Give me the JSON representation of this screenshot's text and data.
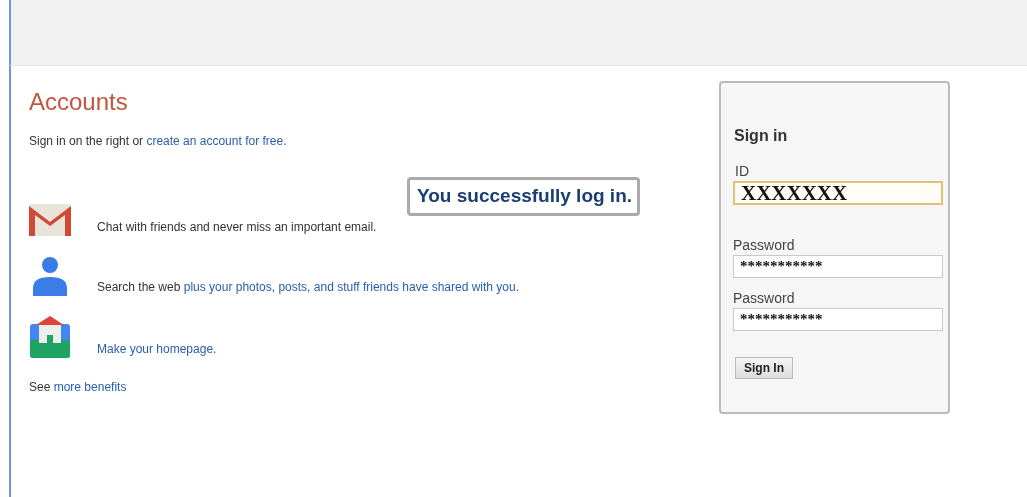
{
  "heading": "Accounts",
  "intro": [
    {
      "kind": "plain",
      "text": "Sign in on the right or "
    },
    {
      "kind": "link",
      "text": "create an account for free."
    }
  ],
  "message": "You successfully log in.",
  "features": [
    {
      "kind": "mail",
      "parts": [
        {
          "kind": "plain",
          "text": "Chat with friends and never miss an important email."
        }
      ]
    },
    {
      "kind": "person",
      "parts": [
        {
          "kind": "plain",
          "text": "Search the web "
        },
        {
          "kind": "link",
          "text": "plus your photos, posts, and stuff friends have shared with you."
        }
      ]
    },
    {
      "kind": "home",
      "parts": [
        {
          "kind": "link",
          "text": "Make your homepage."
        }
      ]
    }
  ],
  "more": [
    {
      "kind": "plain",
      "text": "See "
    },
    {
      "kind": "link",
      "text": "more benefits"
    }
  ],
  "signin": {
    "title": "Sign in",
    "fields": [
      {
        "label": "ID",
        "value": "XXXXXXX",
        "kind": "text",
        "focused": true
      },
      {
        "label": "Password",
        "value": "***********",
        "kind": "password",
        "focused": false
      },
      {
        "label": "Password",
        "value": "***********",
        "kind": "password",
        "focused": false
      }
    ],
    "button": "Sign In"
  }
}
